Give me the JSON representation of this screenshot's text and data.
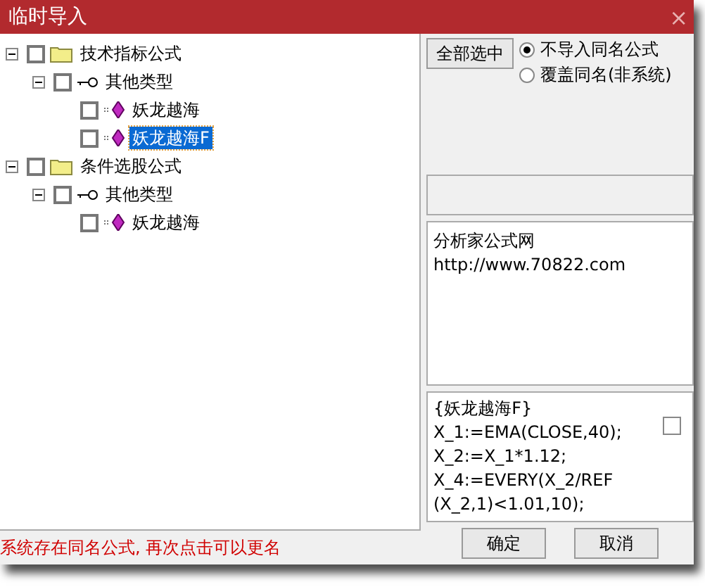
{
  "window": {
    "title": "临时导入",
    "close": "×"
  },
  "tree": [
    {
      "label": "技术指标公式",
      "kind": "folder",
      "expanded": true,
      "checked": false,
      "selected": false,
      "children": [
        {
          "label": "其他类型",
          "kind": "key",
          "expanded": true,
          "checked": false,
          "selected": false,
          "children": [
            {
              "label": "妖龙越海",
              "kind": "formula",
              "checked": false,
              "selected": false
            },
            {
              "label": "妖龙越海F",
              "kind": "formula",
              "checked": false,
              "selected": true
            }
          ]
        }
      ]
    },
    {
      "label": "条件选股公式",
      "kind": "folder",
      "expanded": true,
      "checked": false,
      "selected": false,
      "children": [
        {
          "label": "其他类型",
          "kind": "key",
          "expanded": true,
          "checked": false,
          "selected": false,
          "children": [
            {
              "label": "妖龙越海",
              "kind": "formula",
              "checked": false,
              "selected": false
            }
          ]
        }
      ]
    }
  ],
  "select_all_button": "全部选中",
  "options": [
    {
      "label": "不导入同名公式",
      "selected": true
    },
    {
      "label": "覆盖同名(非系统)",
      "selected": false
    }
  ],
  "info": [
    "分析家公式网",
    "http://www.70822.com"
  ],
  "code": [
    "{妖龙越海F}",
    "X_1:=EMA(CLOSE,40);",
    "X_2:=X_1*1.12;",
    "X_4:=EVERY(X_2/REF",
    "(X_2,1)<1.01,10);"
  ],
  "code_checkbox": {
    "checked": false
  },
  "buttons": [
    "确定",
    "取消"
  ],
  "status": "系统存在同名公式, 再次点击可以更名"
}
